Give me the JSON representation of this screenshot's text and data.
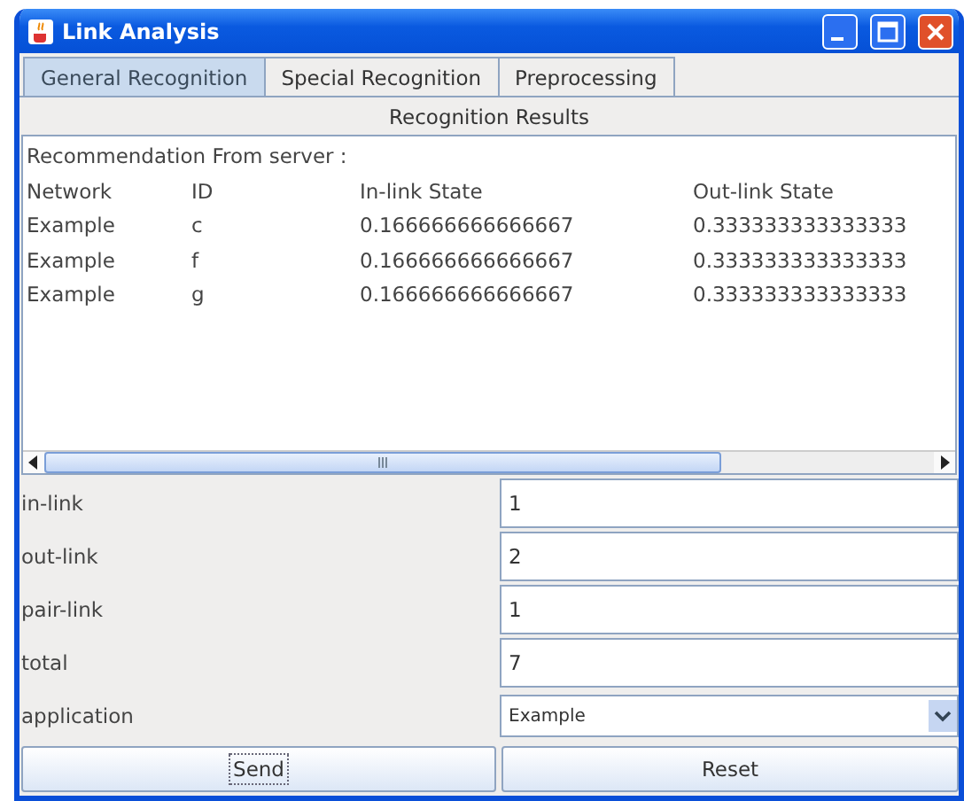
{
  "window": {
    "title": "Link Analysis"
  },
  "tabs": [
    {
      "label": "General Recognition",
      "selected": true
    },
    {
      "label": "Special Recognition",
      "selected": false
    },
    {
      "label": "Preprocessing",
      "selected": false
    }
  ],
  "results": {
    "title": "Recognition Results",
    "heading": "Recommendation From server :",
    "columns": [
      "Network",
      "ID",
      "In-link State",
      "Out-link State"
    ],
    "rows": [
      [
        "Example",
        "c",
        "0.166666666666667",
        "0.333333333333333"
      ],
      [
        "Example",
        "f",
        "0.166666666666667",
        "0.333333333333333"
      ],
      [
        "Example",
        "g",
        "0.166666666666667",
        "0.333333333333333"
      ]
    ]
  },
  "fields": [
    {
      "label": "in-link",
      "kind": "text",
      "value": "1"
    },
    {
      "label": "out-link",
      "kind": "text",
      "value": "2"
    },
    {
      "label": "pair-link",
      "kind": "text",
      "value": "1"
    },
    {
      "label": "total",
      "kind": "text",
      "value": "7"
    },
    {
      "label": "application",
      "kind": "dropdown",
      "value": "Example"
    }
  ],
  "buttons": [
    {
      "label": "Send",
      "focused": true
    },
    {
      "label": "Reset",
      "focused": false
    }
  ]
}
